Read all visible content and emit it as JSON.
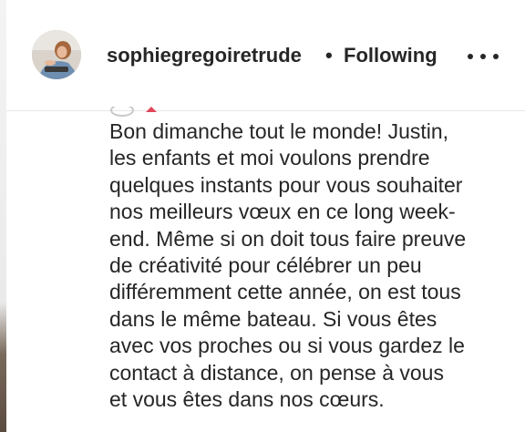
{
  "post_header": {
    "username": "sophiegregoiretrude",
    "separator": "•",
    "follow_status": "Following",
    "more_icon": "more-horizontal-icon"
  },
  "caption": {
    "lines": [
      "Bon dimanche tout le monde! Justin,",
      "les enfants et moi voulons prendre",
      "quelques instants pour vous souhaiter",
      "nos meilleurs vœux en ce long week-",
      "end. Même si on doit tous faire preuve",
      "de créativité pour célébrer un peu",
      "différemment cette année, on est tous",
      "dans le même bateau. Si vous êtes",
      "avec vos proches ou si vous gardez le",
      "contact à distance, on pense à vous",
      "et vous êtes dans nos cœurs."
    ]
  },
  "colors": {
    "text": "#262626",
    "divider": "#e6e6e6",
    "background": "#ffffff"
  }
}
